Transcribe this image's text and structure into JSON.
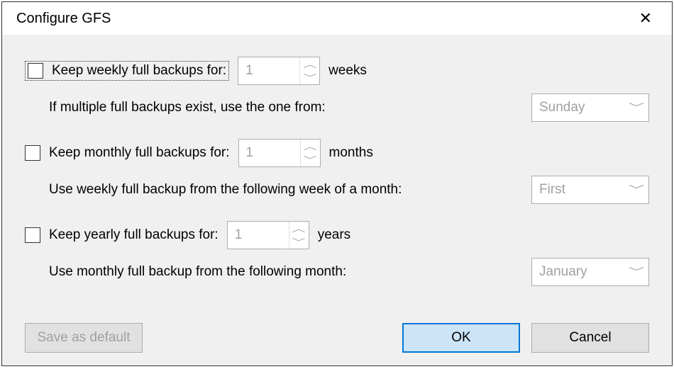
{
  "window": {
    "title": "Configure GFS",
    "close": "✕"
  },
  "weekly": {
    "label": "Keep weekly full backups for:",
    "value": "1",
    "unit": "weeks",
    "sublabel": "If multiple full backups exist, use the one from:",
    "dropdown": "Sunday"
  },
  "monthly": {
    "label": "Keep monthly full backups for:",
    "value": "1",
    "unit": "months",
    "sublabel": "Use weekly full backup from the following week of a month:",
    "dropdown": "First"
  },
  "yearly": {
    "label": "Keep yearly full backups for:",
    "value": "1",
    "unit": "years",
    "sublabel": "Use monthly full backup from the following month:",
    "dropdown": "January"
  },
  "buttons": {
    "save_default": "Save as default",
    "ok": "OK",
    "cancel": "Cancel"
  }
}
